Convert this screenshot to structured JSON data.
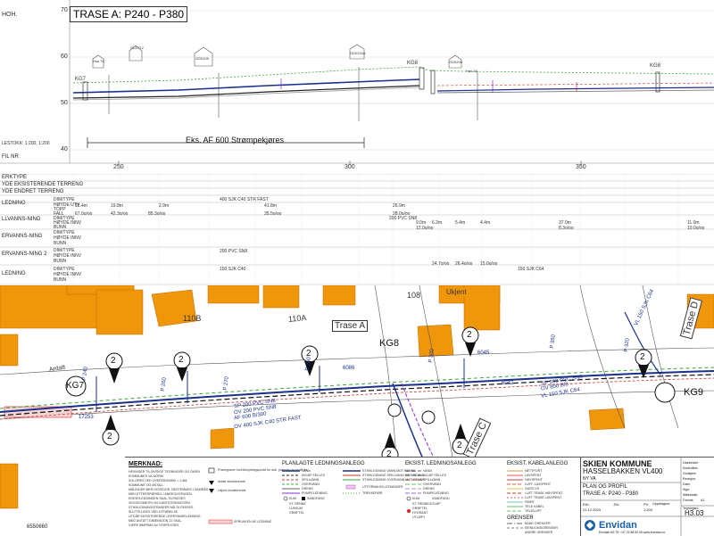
{
  "profile": {
    "title": "TRASE A: P240 - P380",
    "axis_label": "HOH.",
    "scale_label": "LESTOKK: 1:200, 1:200",
    "y_ticks": [
      "70",
      "60",
      "50",
      "40"
    ],
    "x_ticks": [
      "250",
      "300",
      "350"
    ],
    "annotation": "Eks. AF 600 Strømpekjøres",
    "manholes": [
      "KG7",
      "KG8",
      "KG9",
      "KG8"
    ],
    "house_labels": [
      "Hus 7C",
      "GD0712",
      "GD0109",
      "GD0216A",
      "GD0209",
      "Hus 16"
    ]
  },
  "table": {
    "row_labels": [
      "FIL NR",
      "ERKTYPE",
      "YDE EKSISTERENDE TERRENG",
      "YDE ENDRET TERRENG",
      "LEDNING",
      "LLVANNS-NING",
      "ERVANNS-NING",
      "ERVANNS-NING 2",
      "LEDNING"
    ],
    "sub_labels": [
      "DIM/TYPE",
      "HØYDE UTV",
      "TOPP",
      "FALL",
      "DIM/TYPE",
      "HØYDE INNV",
      "BUNN",
      "FALL",
      "DIM/TYPE",
      "HØYDE INNV",
      "BUNN",
      "FALL",
      "DIM/TYPE",
      "HØYDE INNV",
      "BUNN",
      "FALL",
      "DIM/TYPE",
      "HØYDE INNV",
      "BUNN",
      "FALL"
    ],
    "pipe_specs": [
      "400 SJK C40 STR FAST",
      "200 PVC SN8",
      "200 PVC SN8",
      "150 SJK C40",
      "150 SJK C64"
    ],
    "lengths": [
      "15.4m",
      "19.8m",
      "2.9m",
      "41.8m",
      "26.9m",
      "9.0m",
      "6.2m",
      "5.4m",
      "4.4m",
      "37.0m",
      "11.0m"
    ],
    "falls": [
      "67.0o/oo",
      "42.3o/oo",
      "85.3o/oo",
      "35.5o/oo",
      "28.0o/oo",
      "12.0o/oo",
      "24.7o/oo",
      "26.4o/oo",
      "15.0o/oo",
      "8.3o/oo",
      "10.0o/oo"
    ]
  },
  "map": {
    "labels": [
      "Antatt",
      "110B",
      "110A",
      "Trase A",
      "KG8",
      "108",
      "Ukjent",
      "Trase D",
      "KG7",
      "KG9",
      "Trase C",
      "P 270",
      "P 280",
      "P 300",
      "P 320",
      "P 350",
      "VL 150 SJK C64",
      "P 260",
      "P 240",
      "SP 200 PVC SN8",
      "OV 200 PVC SN8",
      "AF 600 B/300",
      "OV 400 SJK C40 STR FAST",
      "SP 200 PVC SN8",
      "OV 800 B/0",
      "VL 150 SJK C64",
      "17253",
      "6086",
      "6045",
      "6042",
      "17252",
      "6550660"
    ],
    "callouts": [
      "2",
      "2",
      "2",
      "2",
      "2",
      "2",
      "2",
      "2"
    ]
  },
  "legend": {
    "notes_title": "MERKNAD:",
    "notes": [
      "HENVISER TIL ØVRIGE TEGNINGER OG SKIEN",
      "KOMMUNES VA-NORM.",
      "SOLGRES VED OVERDEKNING < 1,8M,",
      "KOMMUNE OG ANTALL",
      "MÅLINGER BER HOVEDGR. BESTEMMES I SAMRÅD",
      "MED ETTERSPØRSEL I ANDEGOGFASEN.",
      "EGENTLEDNINGEN SKAL TILPASSES",
      "VEGGEOMETRI OG KANTSTEINSATSEN.",
      "STIKKLEDNINGSTRASEER MÅ TILPASSES",
      "SLUTTELIGES VED UTFØRELSE",
      "UTGÅR EKSISTERENDE OVERVANNSLEDNING",
      "MED ANTATT DIMENSJON 22 SKAL",
      "VÆRE ØMFRØS AV STØPEJORD."
    ],
    "marks": [
      "Prøvegraver ved tilknytningspunkt for avk. justering av profil iht.",
      "Antatt eksisterende",
      "Ukjent eksisterende"
    ],
    "sprukken": "SPRUKKEN AF-LEDNING",
    "planned_title": "PLANLAGTE LEDNINGSANLEGG",
    "planned_items": [
      "VANN",
      "AVLØP FELLES",
      "SPILLVANN",
      "OVERVANN",
      "DRENS",
      "PUMPELEDNING",
      "KUM",
      "SANDFANG",
      "ST. RENNE",
      "LUKSUM",
      "GRØFTEL",
      "AVLØPSKUM",
      "VANNKUMSTL",
      "VANNPUMPE"
    ],
    "planned_items_2": [
      "STIKKLEDNING VANN MOT RENNE",
      "STIKKLEDNING SPILLVANN MOT RENNE",
      "STIKKLEDNING OVERVANN MOT RENNE",
      "UTFORBAHOLLEDNINGER",
      "TREKKERØR"
    ],
    "existing_title": "EKSIST. LEDNINGSANLEGG",
    "existing_items": [
      "VANN",
      "AVLØP FELLES",
      "SPILLVANN",
      "OVERVANN",
      "DRENS",
      "PUMPELEDNING",
      "KUM",
      "SANDFANG",
      "ST. RENNE/UTLØP",
      "GRØFTEL",
      "HYDRANT",
      "UTLØPY"
    ],
    "cable_title": "EKSIST. KABELANLEGG",
    "cable_items": [
      "NETTPORT",
      "LAVSPENT",
      "HØYSPENT",
      "LUFT. LAVSPENT",
      "GATELYS",
      "LUFT TRASE HØYSPENT",
      "LUFT TRASE LAVSPENT",
      "FIBER",
      "TELE KABEL",
      "TELE/LUFT"
    ],
    "borders_title": "GRENSER",
    "borders": [
      "BANE GRENSER",
      "EIENDOMSGRENSER",
      "ANDRE GRENSER"
    ]
  },
  "titleblock": {
    "company": "SKIEN KOMMUNE",
    "project": "HASSELBAKKEN VL400",
    "sub": "NY VA",
    "drawing_title": "PLAN OG PROFIL",
    "drawing_sub": "TRASE A: P240 - P380",
    "drawing_no": "H3.03",
    "firm": "Envidan",
    "firm_footer": "Envidan AS   Tlf: +47 22 86 50 00   www.envidan.no",
    "scale": "1:200",
    "date": "21.12.2023",
    "fields": [
      "Utarbeidet:",
      "Kontrollert:",
      "Godkjent:",
      "Revisjon:",
      "Dato:",
      "Sign:",
      "Målestokk:",
      "Format:",
      "A1",
      "Oppdragsnr:",
      "Tegningsnr:"
    ],
    "initials": [
      "EKL",
      "JSL",
      "PV"
    ]
  }
}
